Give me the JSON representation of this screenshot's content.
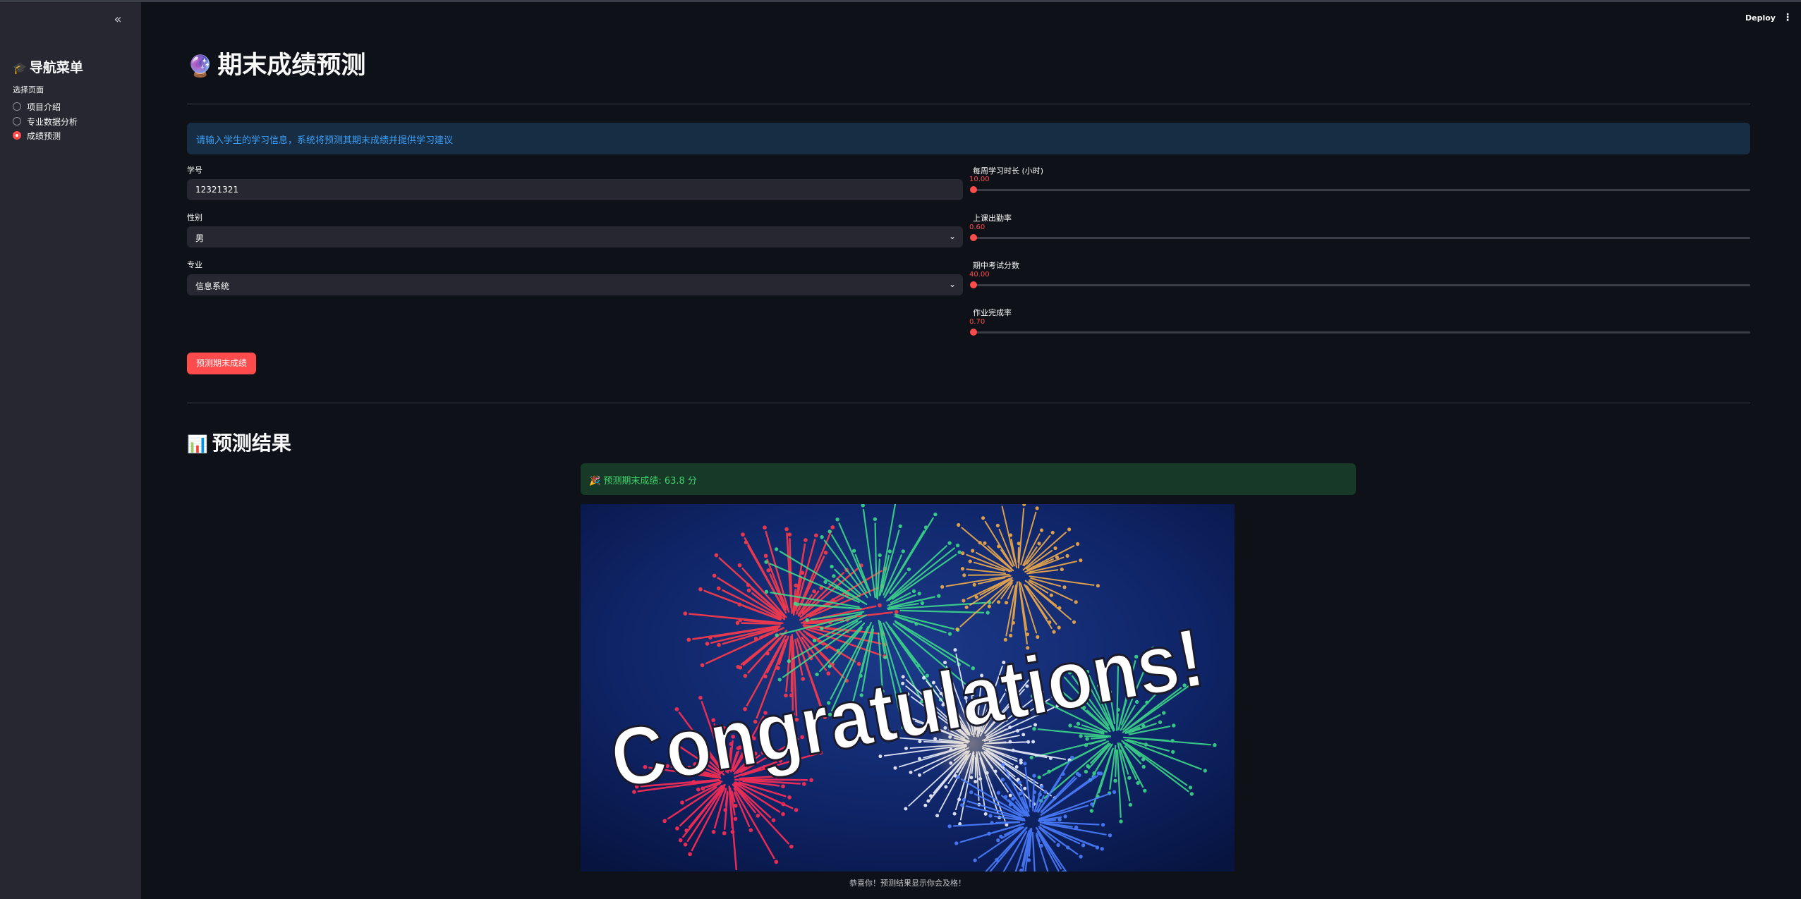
{
  "sidebar": {
    "collapse_icon": "double-chevron-left-icon",
    "title_emoji": "🎓",
    "title": "导航菜单",
    "select_label": "选择页面",
    "options": [
      {
        "label": "项目介绍",
        "selected": false
      },
      {
        "label": "专业数据分析",
        "selected": false
      },
      {
        "label": "成绩预测",
        "selected": true
      }
    ]
  },
  "header": {
    "deploy_label": "Deploy",
    "menu_icon": "kebab-menu-icon"
  },
  "main": {
    "title_emoji": "🔮",
    "title": "期末成绩预测",
    "info_text": "请输入学生的学习信息，系统将预测其期末成绩并提供学习建议",
    "form": {
      "student_id": {
        "label": "学号",
        "value": "12321321"
      },
      "gender": {
        "label": "性别",
        "value": "男"
      },
      "major": {
        "label": "专业",
        "value": "信息系统"
      },
      "sliders": [
        {
          "label": "每周学习时长 (小时)",
          "value": "10.00",
          "fraction": 0.0
        },
        {
          "label": "上课出勤率",
          "value": "0.60",
          "fraction": 0.0
        },
        {
          "label": "期中考试分数",
          "value": "40.00",
          "fraction": 0.0
        },
        {
          "label": "作业完成率",
          "value": "0.70",
          "fraction": 0.0
        }
      ]
    },
    "predict_button": "预测期末成绩",
    "result": {
      "title_emoji": "📊",
      "title": "预测结果",
      "success_text": "🎉 预测期末成绩: 63.8 分",
      "image_text": "Congratulations!",
      "caption": "恭喜你！预测结果显示你会及格！"
    }
  },
  "colors": {
    "accent": "#ff4b4b",
    "background": "#0e1117",
    "sidebar": "#262730",
    "info_bg": "#172d43",
    "info_text": "#3d9df3",
    "success_bg": "#173928",
    "success_text": "#3dd56d"
  }
}
